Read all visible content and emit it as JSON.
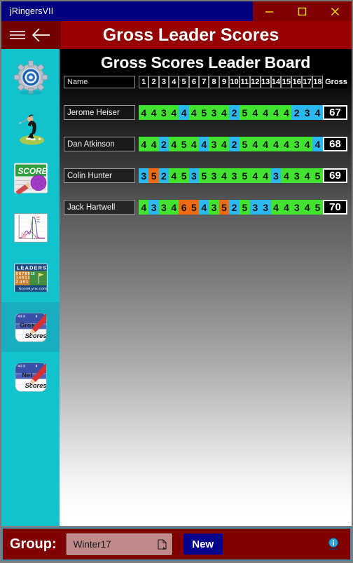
{
  "window": {
    "title": "jRingersVII",
    "controls": [
      {
        "name": "minimize",
        "glyph": "minimize-icon"
      },
      {
        "name": "maximize",
        "glyph": "maximize-icon"
      },
      {
        "name": "close",
        "glyph": "close-icon"
      }
    ]
  },
  "appbar": {
    "menu_icon": "hamburger-menu-icon",
    "back_icon": "back-arrow-icon",
    "title": "Gross Leader Scores"
  },
  "sidebar": {
    "background": "#12C3CE",
    "selected_background": "#17AEBE",
    "items": [
      {
        "label": "Settings",
        "icon": "gear-settings-icon",
        "selected": false
      },
      {
        "label": "Golfer",
        "icon": "golfer-swing-icon",
        "selected": false
      },
      {
        "label": "Score Card",
        "icon": "score-card-icon",
        "selected": false
      },
      {
        "label": "Statistics",
        "icon": "statistics-chart-icon",
        "selected": false
      },
      {
        "label": "Leaders",
        "icon": "leaders-board-icon",
        "selected": false
      },
      {
        "label": "Gross Scores",
        "icon": "gross-scores-icon",
        "selected": true
      },
      {
        "label": "Net Scores",
        "icon": "net-scores-icon",
        "selected": false
      }
    ]
  },
  "board": {
    "title": "Gross Scores Leader Board",
    "columns": {
      "name": "Name",
      "holes": [
        "1",
        "2",
        "3",
        "4",
        "5",
        "6",
        "7",
        "8",
        "9",
        "10",
        "11",
        "12",
        "13",
        "14",
        "15",
        "16",
        "17",
        "18"
      ],
      "gross": "Gross"
    },
    "colors": {
      "green": "#41E230",
      "blue": "#29B8F0",
      "orange": "#F06A10"
    },
    "rows": [
      {
        "name": "Jerome Heiser",
        "gross": "67",
        "scores": [
          {
            "v": "4",
            "c": "green"
          },
          {
            "v": "4",
            "c": "green"
          },
          {
            "v": "3",
            "c": "green"
          },
          {
            "v": "4",
            "c": "green"
          },
          {
            "v": "4",
            "c": "blue"
          },
          {
            "v": "4",
            "c": "green"
          },
          {
            "v": "5",
            "c": "green"
          },
          {
            "v": "3",
            "c": "green"
          },
          {
            "v": "4",
            "c": "green"
          },
          {
            "v": "2",
            "c": "blue"
          },
          {
            "v": "5",
            "c": "green"
          },
          {
            "v": "4",
            "c": "green"
          },
          {
            "v": "4",
            "c": "green"
          },
          {
            "v": "4",
            "c": "green"
          },
          {
            "v": "4",
            "c": "green"
          },
          {
            "v": "2",
            "c": "blue"
          },
          {
            "v": "3",
            "c": "blue"
          },
          {
            "v": "4",
            "c": "blue"
          }
        ]
      },
      {
        "name": "Dan Atkinson",
        "gross": "68",
        "scores": [
          {
            "v": "4",
            "c": "green"
          },
          {
            "v": "4",
            "c": "green"
          },
          {
            "v": "2",
            "c": "blue"
          },
          {
            "v": "4",
            "c": "green"
          },
          {
            "v": "5",
            "c": "green"
          },
          {
            "v": "4",
            "c": "green"
          },
          {
            "v": "4",
            "c": "blue"
          },
          {
            "v": "3",
            "c": "green"
          },
          {
            "v": "4",
            "c": "green"
          },
          {
            "v": "2",
            "c": "blue"
          },
          {
            "v": "5",
            "c": "green"
          },
          {
            "v": "4",
            "c": "green"
          },
          {
            "v": "4",
            "c": "green"
          },
          {
            "v": "4",
            "c": "green"
          },
          {
            "v": "4",
            "c": "green"
          },
          {
            "v": "3",
            "c": "green"
          },
          {
            "v": "4",
            "c": "green"
          },
          {
            "v": "4",
            "c": "blue"
          }
        ]
      },
      {
        "name": "Colin Hunter",
        "gross": "69",
        "scores": [
          {
            "v": "3",
            "c": "blue"
          },
          {
            "v": "5",
            "c": "orange"
          },
          {
            "v": "2",
            "c": "blue"
          },
          {
            "v": "4",
            "c": "green"
          },
          {
            "v": "5",
            "c": "green"
          },
          {
            "v": "3",
            "c": "blue"
          },
          {
            "v": "5",
            "c": "green"
          },
          {
            "v": "3",
            "c": "green"
          },
          {
            "v": "4",
            "c": "green"
          },
          {
            "v": "3",
            "c": "green"
          },
          {
            "v": "5",
            "c": "green"
          },
          {
            "v": "4",
            "c": "green"
          },
          {
            "v": "4",
            "c": "green"
          },
          {
            "v": "3",
            "c": "blue"
          },
          {
            "v": "4",
            "c": "green"
          },
          {
            "v": "3",
            "c": "green"
          },
          {
            "v": "4",
            "c": "green"
          },
          {
            "v": "5",
            "c": "green"
          }
        ]
      },
      {
        "name": "Jack Hartwell",
        "gross": "70",
        "scores": [
          {
            "v": "4",
            "c": "green"
          },
          {
            "v": "3",
            "c": "blue"
          },
          {
            "v": "3",
            "c": "green"
          },
          {
            "v": "4",
            "c": "green"
          },
          {
            "v": "6",
            "c": "orange"
          },
          {
            "v": "5",
            "c": "orange"
          },
          {
            "v": "4",
            "c": "blue"
          },
          {
            "v": "3",
            "c": "green"
          },
          {
            "v": "5",
            "c": "orange"
          },
          {
            "v": "2",
            "c": "blue"
          },
          {
            "v": "5",
            "c": "green"
          },
          {
            "v": "3",
            "c": "blue"
          },
          {
            "v": "3",
            "c": "blue"
          },
          {
            "v": "4",
            "c": "green"
          },
          {
            "v": "4",
            "c": "green"
          },
          {
            "v": "3",
            "c": "green"
          },
          {
            "v": "4",
            "c": "green"
          },
          {
            "v": "5",
            "c": "green"
          }
        ]
      }
    ]
  },
  "footer": {
    "group_label": "Group:",
    "group_value": "Winter17",
    "group_icon": "document-page-icon",
    "new_button": "New",
    "info_icon": "info-icon"
  }
}
